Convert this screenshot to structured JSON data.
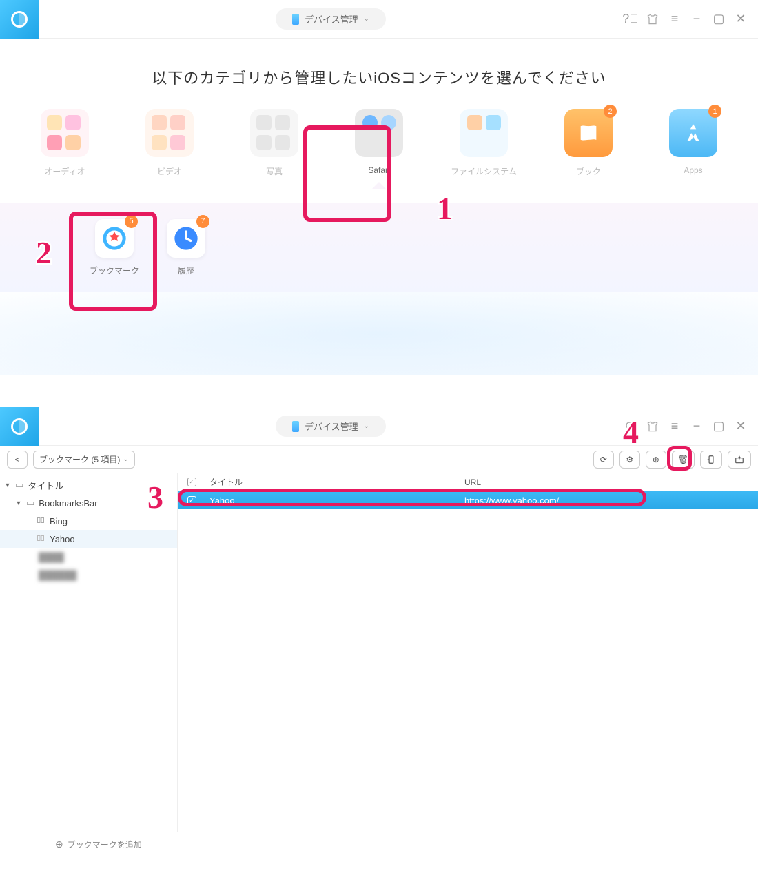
{
  "window1": {
    "device_label": "デバイス管理",
    "heading": "以下のカテゴリから管理したいiOSコンテンツを選んでください",
    "categories": [
      {
        "label": "オーディオ"
      },
      {
        "label": "ビデオ"
      },
      {
        "label": "写真"
      },
      {
        "label": "Safari"
      },
      {
        "label": "ファイルシステム"
      },
      {
        "label": "ブック",
        "badge": "2"
      },
      {
        "label": "Apps",
        "badge": "1"
      }
    ],
    "sub_items": [
      {
        "label": "ブックマーク",
        "badge": "5"
      },
      {
        "label": "履歴",
        "badge": "7"
      }
    ]
  },
  "callouts": {
    "n1": "1",
    "n2": "2",
    "n3": "3",
    "n4": "4"
  },
  "window2": {
    "device_label": "デバイス管理",
    "breadcrumb": "ブックマーク (5 項目)",
    "tree": {
      "root": "タイトル",
      "folder": "BookmarksBar",
      "items": [
        "Bing",
        "Yahoo"
      ]
    },
    "table": {
      "col_title": "タイトル",
      "col_url": "URL",
      "row_title": "Yahoo",
      "row_url": "https://www.yahoo.com/"
    },
    "footer": "ブックマークを追加"
  }
}
